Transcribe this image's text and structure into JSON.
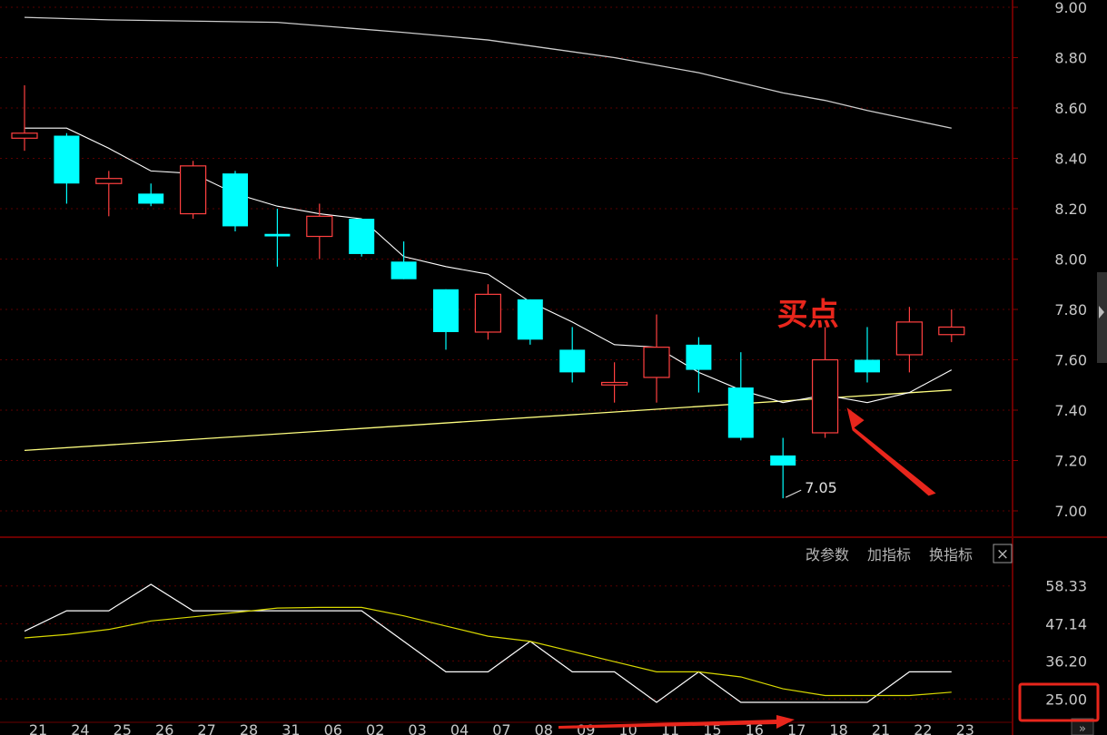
{
  "chart_data": [
    {
      "type": "candlestick",
      "x": [
        "21",
        "24",
        "25",
        "26",
        "27",
        "28",
        "31",
        "06",
        "02",
        "03",
        "04",
        "07",
        "08",
        "09",
        "10",
        "11",
        "15",
        "16",
        "17",
        "18",
        "21",
        "22",
        "23"
      ],
      "ohlc": [
        {
          "open": 8.48,
          "high": 8.69,
          "low": 8.43,
          "close": 8.5
        },
        {
          "open": 8.49,
          "high": 8.5,
          "low": 8.22,
          "close": 8.3
        },
        {
          "open": 8.3,
          "high": 8.35,
          "low": 8.17,
          "close": 8.32
        },
        {
          "open": 8.26,
          "high": 8.3,
          "low": 8.21,
          "close": 8.22
        },
        {
          "open": 8.18,
          "high": 8.39,
          "low": 8.16,
          "close": 8.37
        },
        {
          "open": 8.34,
          "high": 8.35,
          "low": 8.11,
          "close": 8.13
        },
        {
          "open": 8.1,
          "high": 8.2,
          "low": 7.97,
          "close": 8.09
        },
        {
          "open": 8.09,
          "high": 8.22,
          "low": 8.0,
          "close": 8.17
        },
        {
          "open": 8.16,
          "high": 8.16,
          "low": 8.01,
          "close": 8.02
        },
        {
          "open": 7.99,
          "high": 8.07,
          "low": 7.92,
          "close": 7.92
        },
        {
          "open": 7.88,
          "high": 7.88,
          "low": 7.64,
          "close": 7.71
        },
        {
          "open": 7.71,
          "high": 7.9,
          "low": 7.68,
          "close": 7.86
        },
        {
          "open": 7.84,
          "high": 7.84,
          "low": 7.66,
          "close": 7.68
        },
        {
          "open": 7.64,
          "high": 7.73,
          "low": 7.51,
          "close": 7.55
        },
        {
          "open": 7.5,
          "high": 7.59,
          "low": 7.43,
          "close": 7.51
        },
        {
          "open": 7.53,
          "high": 7.78,
          "low": 7.43,
          "close": 7.65
        },
        {
          "open": 7.66,
          "high": 7.69,
          "low": 7.47,
          "close": 7.56
        },
        {
          "open": 7.49,
          "high": 7.63,
          "low": 7.28,
          "close": 7.29
        },
        {
          "open": 7.22,
          "high": 7.29,
          "low": 7.05,
          "close": 7.18
        },
        {
          "open": 7.31,
          "high": 7.73,
          "low": 7.29,
          "close": 7.6
        },
        {
          "open": 7.6,
          "high": 7.73,
          "low": 7.51,
          "close": 7.55
        },
        {
          "open": 7.62,
          "high": 7.81,
          "low": 7.55,
          "close": 7.75
        },
        {
          "open": 7.7,
          "high": 7.8,
          "low": 7.67,
          "close": 7.73
        }
      ],
      "ma_white": [
        8.52,
        8.52,
        8.44,
        8.35,
        8.34,
        8.26,
        8.21,
        8.18,
        8.16,
        8.01,
        7.97,
        7.94,
        7.83,
        7.75,
        7.66,
        7.65,
        7.55,
        7.48,
        7.43,
        7.46,
        7.43,
        7.47,
        7.56
      ],
      "ma_long_white": [
        [
          0,
          8.96
        ],
        [
          2,
          8.95
        ],
        [
          6,
          8.94
        ],
        [
          9,
          8.9
        ],
        [
          11,
          8.87
        ],
        [
          14,
          8.8
        ],
        [
          16,
          8.74
        ],
        [
          18,
          8.66
        ],
        [
          19,
          8.63
        ],
        [
          20,
          8.59
        ],
        [
          22,
          8.52
        ]
      ],
      "ma_yellow": [
        [
          0,
          7.24
        ],
        [
          22,
          7.48
        ]
      ],
      "ylim": [
        7.0,
        9.0
      ],
      "yticks": [
        "9.00",
        "8.80",
        "8.60",
        "8.40",
        "8.20",
        "8.00",
        "7.80",
        "7.60",
        "7.40",
        "7.20",
        "7.00"
      ],
      "annotations": [
        {
          "text": "买点",
          "index": 19
        },
        {
          "text": "7.05",
          "index": 18,
          "value": 7.05
        }
      ]
    },
    {
      "type": "line",
      "series": [
        {
          "values": [
            45,
            51,
            51,
            58.8,
            51,
            51,
            51,
            51,
            51,
            42,
            33,
            33,
            42,
            33,
            33,
            24,
            33,
            24,
            24,
            24,
            24,
            33,
            33
          ]
        },
        {
          "values": [
            43,
            44,
            45.5,
            48,
            49.2,
            50.5,
            51.8,
            52,
            52,
            49.5,
            46.5,
            43.5,
            42,
            39,
            36,
            33,
            33,
            31.5,
            28,
            26,
            26,
            26,
            27
          ]
        }
      ],
      "ylim": [
        24,
        62
      ],
      "yticks": [
        "58.33",
        "47.14",
        "36.20",
        "25.00"
      ]
    }
  ],
  "indicator_panel": {
    "buttons": [
      "改参数",
      "加指标",
      "换指标"
    ],
    "close_symbol": "×"
  },
  "colors": {
    "up": "#ff4040",
    "down": "#00ffff",
    "ma_white": "#ffffff",
    "ma_long": "#cccccc",
    "ma_yellow": "#ffff80",
    "annotation_red": "#e8261c",
    "grid": "#5a0000"
  }
}
